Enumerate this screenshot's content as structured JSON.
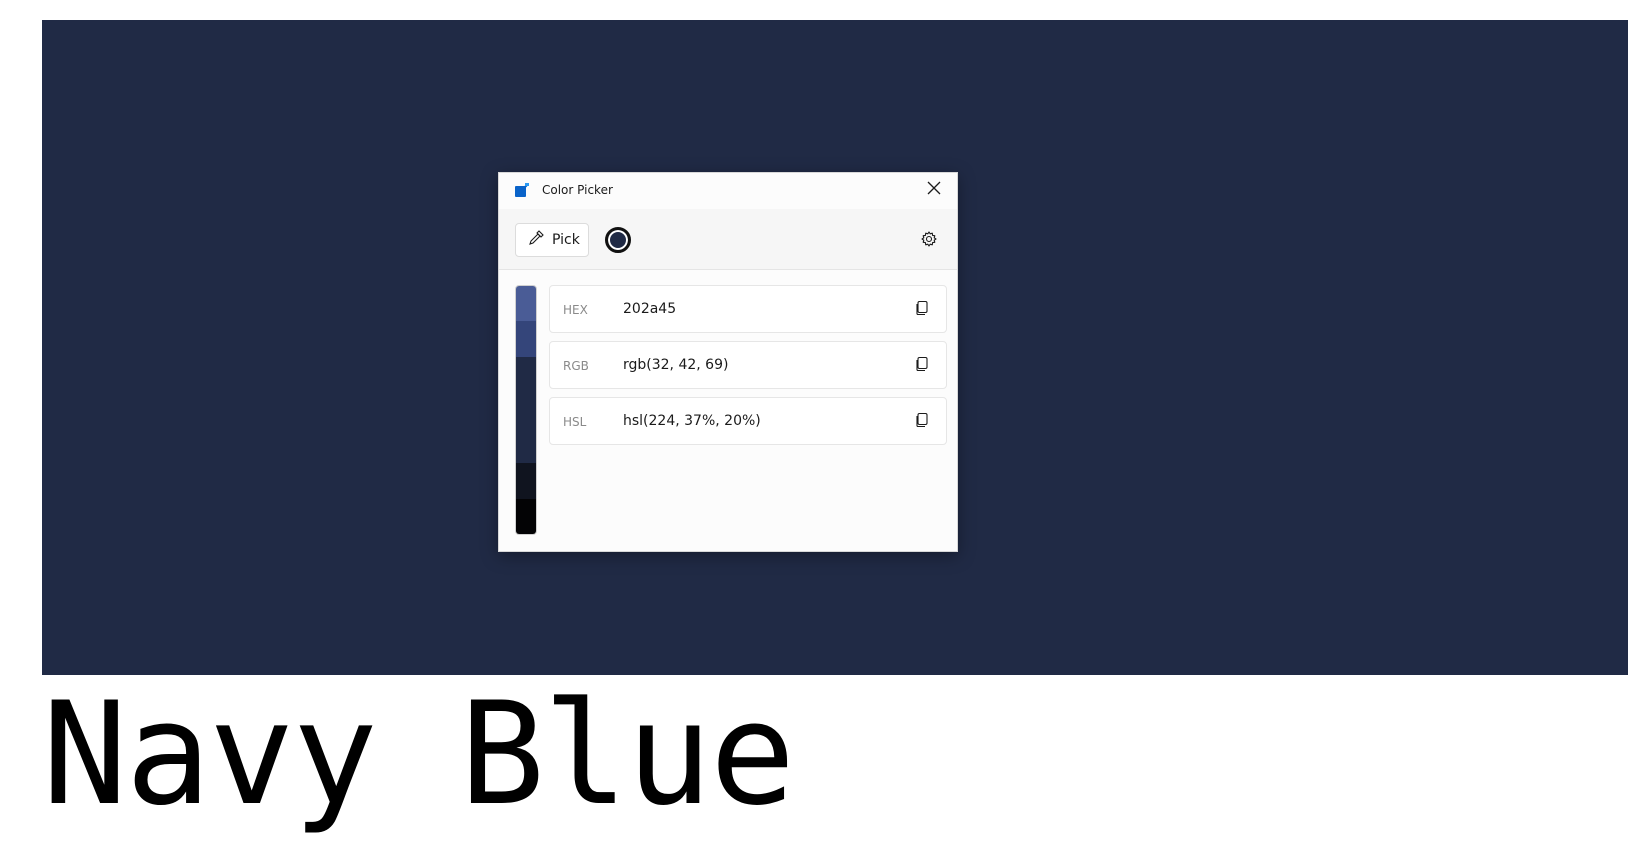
{
  "background_color": "#202a45",
  "caption": "Navy Blue",
  "window": {
    "title": "Color Picker",
    "app_icon": "color-picker-app-icon",
    "close_icon": "close-icon"
  },
  "toolbar": {
    "pick_label": "Pick",
    "pick_icon": "eyedropper-icon",
    "current_color": "#202a45",
    "settings_icon": "gear-icon"
  },
  "shades": [
    "#4a5c96",
    "#34457a",
    "#202a45",
    "#202a45",
    "#202a45",
    "#10141f",
    "#030305"
  ],
  "formats": [
    {
      "label": "HEX",
      "value": "202a45",
      "copy_icon": "copy-icon"
    },
    {
      "label": "RGB",
      "value": "rgb(32, 42, 69)",
      "copy_icon": "copy-icon"
    },
    {
      "label": "HSL",
      "value": "hsl(224, 37%, 20%)",
      "copy_icon": "copy-icon"
    }
  ]
}
